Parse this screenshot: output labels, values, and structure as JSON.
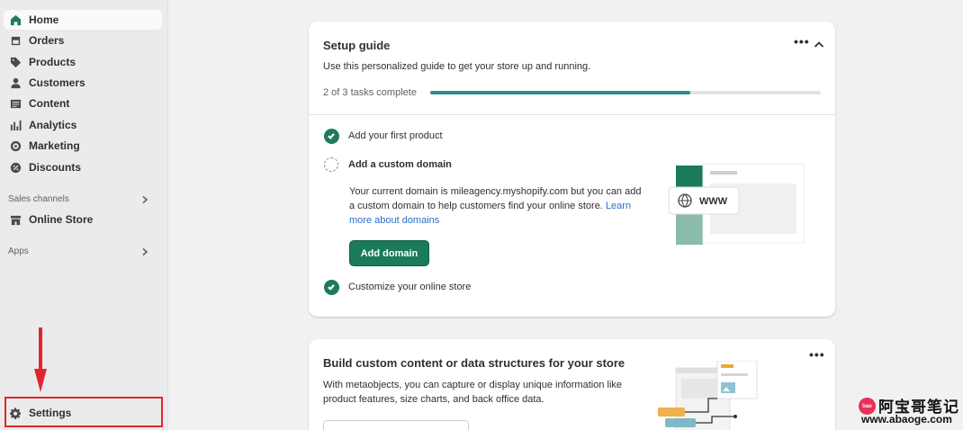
{
  "sidebar": {
    "items": [
      {
        "label": "Home",
        "icon": "home-icon",
        "active": true
      },
      {
        "label": "Orders",
        "icon": "orders-icon"
      },
      {
        "label": "Products",
        "icon": "tag-icon"
      },
      {
        "label": "Customers",
        "icon": "person-icon"
      },
      {
        "label": "Content",
        "icon": "content-icon"
      },
      {
        "label": "Analytics",
        "icon": "bar-chart-icon"
      },
      {
        "label": "Marketing",
        "icon": "target-icon"
      },
      {
        "label": "Discounts",
        "icon": "discount-icon"
      }
    ],
    "sales_channels_label": "Sales channels",
    "online_store_label": "Online Store",
    "apps_label": "Apps",
    "settings_label": "Settings"
  },
  "setup_guide": {
    "title": "Setup guide",
    "subtitle": "Use this personalized guide to get your store up and running.",
    "progress_text": "2 of 3 tasks complete",
    "progress_fraction": 0.667,
    "tasks": [
      {
        "label": "Add your first product",
        "done": true
      },
      {
        "label": "Add a custom domain",
        "done": false
      },
      {
        "label": "Customize your online store",
        "done": true
      }
    ],
    "domain_desc": "Your current domain is mileagency.myshopify.com but you can add a custom domain to help customers find your online store.",
    "domain_link": "Learn more about domains",
    "add_domain_button": "Add domain",
    "illustration_text": "WWW"
  },
  "custom_content": {
    "title": "Build custom content or data structures for your store",
    "description": "With metaobjects, you can capture or display unique information like product features, size charts, and back office data."
  },
  "watermark": {
    "logo_text": "bao",
    "title": "阿宝哥笔记",
    "url": "www.abaoge.com"
  },
  "colors": {
    "primary_button": "#1a7a5a",
    "progress": "#2c8c8a",
    "highlight_box": "#e0262c"
  }
}
